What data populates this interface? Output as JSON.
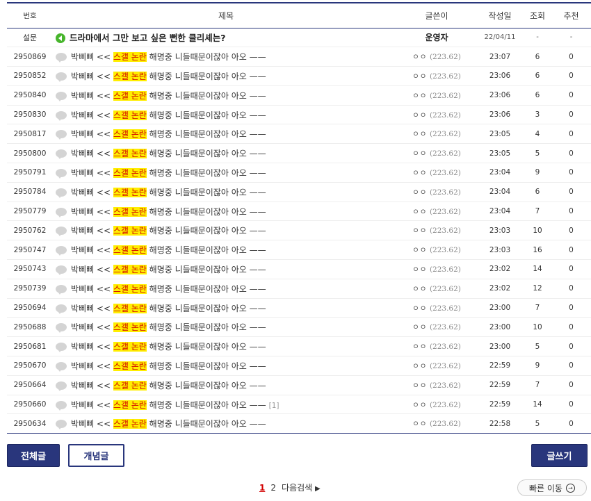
{
  "header": {
    "num": "번호",
    "title": "제목",
    "writer": "글쓴이",
    "date": "작성일",
    "views": "조회",
    "recommend": "추천"
  },
  "notice": {
    "num": "설문",
    "title": "드라마에서 그만 보고 싶은 뻔한 클리셰는?",
    "writer": "운영자",
    "date": "22/04/11",
    "views": "-",
    "recommend": "-"
  },
  "post_template": {
    "prefix": "박삐삐 << ",
    "highlight": "스갤 논란",
    "suffix": " 해명중 니들때문이잖아 아오 ——",
    "writer_name": "ㅇㅇ",
    "writer_ip": "(223.62)"
  },
  "rows": [
    {
      "num": "2950869",
      "date": "23:07",
      "views": "6",
      "recommend": "0",
      "comments": ""
    },
    {
      "num": "2950852",
      "date": "23:06",
      "views": "6",
      "recommend": "0",
      "comments": ""
    },
    {
      "num": "2950840",
      "date": "23:06",
      "views": "6",
      "recommend": "0",
      "comments": ""
    },
    {
      "num": "2950830",
      "date": "23:06",
      "views": "3",
      "recommend": "0",
      "comments": ""
    },
    {
      "num": "2950817",
      "date": "23:05",
      "views": "4",
      "recommend": "0",
      "comments": ""
    },
    {
      "num": "2950800",
      "date": "23:05",
      "views": "5",
      "recommend": "0",
      "comments": ""
    },
    {
      "num": "2950791",
      "date": "23:04",
      "views": "9",
      "recommend": "0",
      "comments": ""
    },
    {
      "num": "2950784",
      "date": "23:04",
      "views": "6",
      "recommend": "0",
      "comments": ""
    },
    {
      "num": "2950779",
      "date": "23:04",
      "views": "7",
      "recommend": "0",
      "comments": ""
    },
    {
      "num": "2950762",
      "date": "23:03",
      "views": "10",
      "recommend": "0",
      "comments": ""
    },
    {
      "num": "2950747",
      "date": "23:03",
      "views": "16",
      "recommend": "0",
      "comments": ""
    },
    {
      "num": "2950743",
      "date": "23:02",
      "views": "14",
      "recommend": "0",
      "comments": ""
    },
    {
      "num": "2950739",
      "date": "23:02",
      "views": "12",
      "recommend": "0",
      "comments": ""
    },
    {
      "num": "2950694",
      "date": "23:00",
      "views": "7",
      "recommend": "0",
      "comments": ""
    },
    {
      "num": "2950688",
      "date": "23:00",
      "views": "10",
      "recommend": "0",
      "comments": ""
    },
    {
      "num": "2950681",
      "date": "23:00",
      "views": "5",
      "recommend": "0",
      "comments": ""
    },
    {
      "num": "2950670",
      "date": "22:59",
      "views": "9",
      "recommend": "0",
      "comments": ""
    },
    {
      "num": "2950664",
      "date": "22:59",
      "views": "7",
      "recommend": "0",
      "comments": ""
    },
    {
      "num": "2950660",
      "date": "22:59",
      "views": "14",
      "recommend": "0",
      "comments": "[1]"
    },
    {
      "num": "2950634",
      "date": "22:58",
      "views": "5",
      "recommend": "0",
      "comments": ""
    }
  ],
  "buttons": {
    "all": "전체글",
    "concept": "개념글",
    "write": "글쓰기"
  },
  "pager": {
    "page1": "1",
    "page2": "2",
    "next": "다음검색",
    "next_arrow": "▶"
  },
  "quick_move": {
    "label": "빠른 이동",
    "icon_glyph": "→"
  },
  "colors": {
    "navy": "#29367c",
    "highlight_bg": "#ffee00",
    "highlight_text": "#d20000",
    "notice_icon": "#47b52c"
  },
  "icons": {
    "post": "speech-bubble-icon",
    "notice": "speaker-icon",
    "quick": "arrow-circle-icon"
  }
}
